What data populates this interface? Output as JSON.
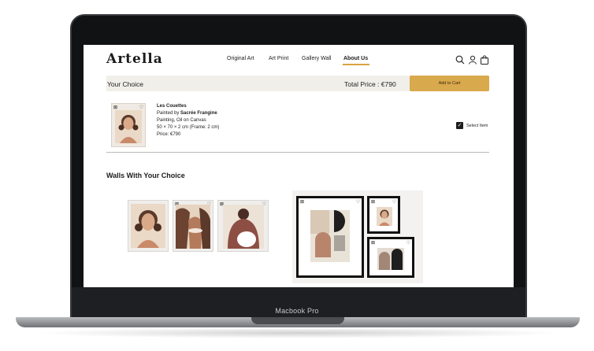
{
  "device": {
    "label": "Macbook Pro"
  },
  "header": {
    "logo": "Artella",
    "nav": [
      "Original Art",
      "Art Print",
      "Gallery Wall",
      "About Us"
    ],
    "active_nav": "About Us",
    "icons": [
      "search-icon",
      "user-icon",
      "cart-icon"
    ]
  },
  "choice": {
    "title": "Your Choice",
    "total_price": "Total Price : €790",
    "add_to_cart": "Add to Cart"
  },
  "product": {
    "title": "Les Couettes",
    "painted_by_prefix": "Painted by ",
    "artist": "Sacrée Frangine",
    "medium": "Painting, Oil on Canvas",
    "dimensions": "50 × 70 × 2 cm (Frame: 2 cm)",
    "price": "Price: €790",
    "select_label": "Select Item",
    "selected": true
  },
  "walls": {
    "title": "Walls With Your Choice"
  },
  "colors": {
    "accent": "#d9a94d",
    "bar_bg": "#f1efea",
    "underline": "#d9a441"
  }
}
